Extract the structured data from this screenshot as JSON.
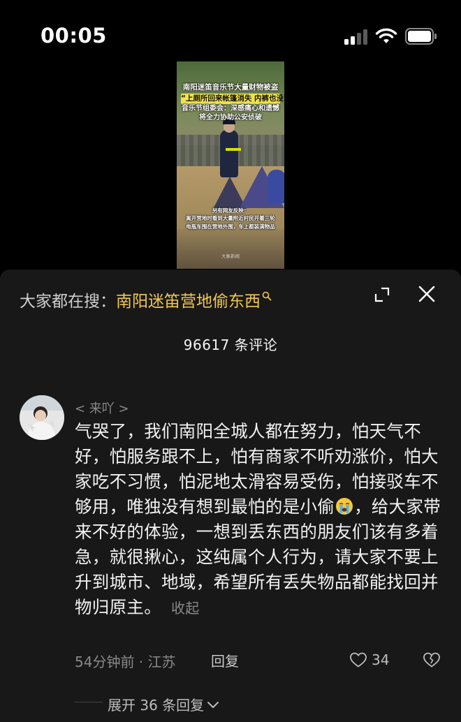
{
  "status_bar": {
    "time": "00:05"
  },
  "video": {
    "title_line1": "南阳迷笛音乐节大量财物被盗",
    "title_line2": "“上厕所回来帐篷消失 内裤也没了”",
    "title_line3": "音乐节组委会：深感痛心和遗憾",
    "title_line4": "将全力协助公安侦破",
    "caption_line1": "另有网友反映：",
    "caption_line2": "离开营地时看到大量附近村民开着三轮",
    "caption_line3": "电瓶车围在营地外围，车上都装满物品",
    "watermark": "大象新闻"
  },
  "search_bar": {
    "prefix": "大家都在搜：",
    "keyword": "南阳迷笛营地偷东西"
  },
  "comment_count": "96617 条评论",
  "comment": {
    "username": "< 来吖 >",
    "text_before_emoji": "气哭了，我们南阳全城人都在努力，怕天气不好，怕服务跟不上，怕有商家不听劝涨价，怕大家吃不习惯，怕泥地太滑容易受伤，怕接驳车不够用，唯独没有想到最怕的是小偷",
    "text_after_emoji": "，给大家带来不好的体验，一想到丢东西的朋友们该有多着急，就很揪心，这纯属个人行为，请大家不要上升到城市、地域，希望所有丢失物品都能找回并物归原主。",
    "collapse_label": "收起",
    "meta": "54分钟前 · 江苏",
    "reply_label": "回复",
    "like_count": "34",
    "expand_replies_label": "展开 36 条回复"
  },
  "colors": {
    "accent_keyword": "#f2c94c",
    "panel_bg": "#181818",
    "secondary_text": "#8a8a8a"
  },
  "icons": [
    "signal-icon",
    "wifi-icon",
    "battery-icon",
    "search-icon",
    "expand-icon",
    "close-icon",
    "crying-emoji-icon",
    "heart-icon",
    "broken-heart-icon",
    "chevron-down-icon"
  ]
}
